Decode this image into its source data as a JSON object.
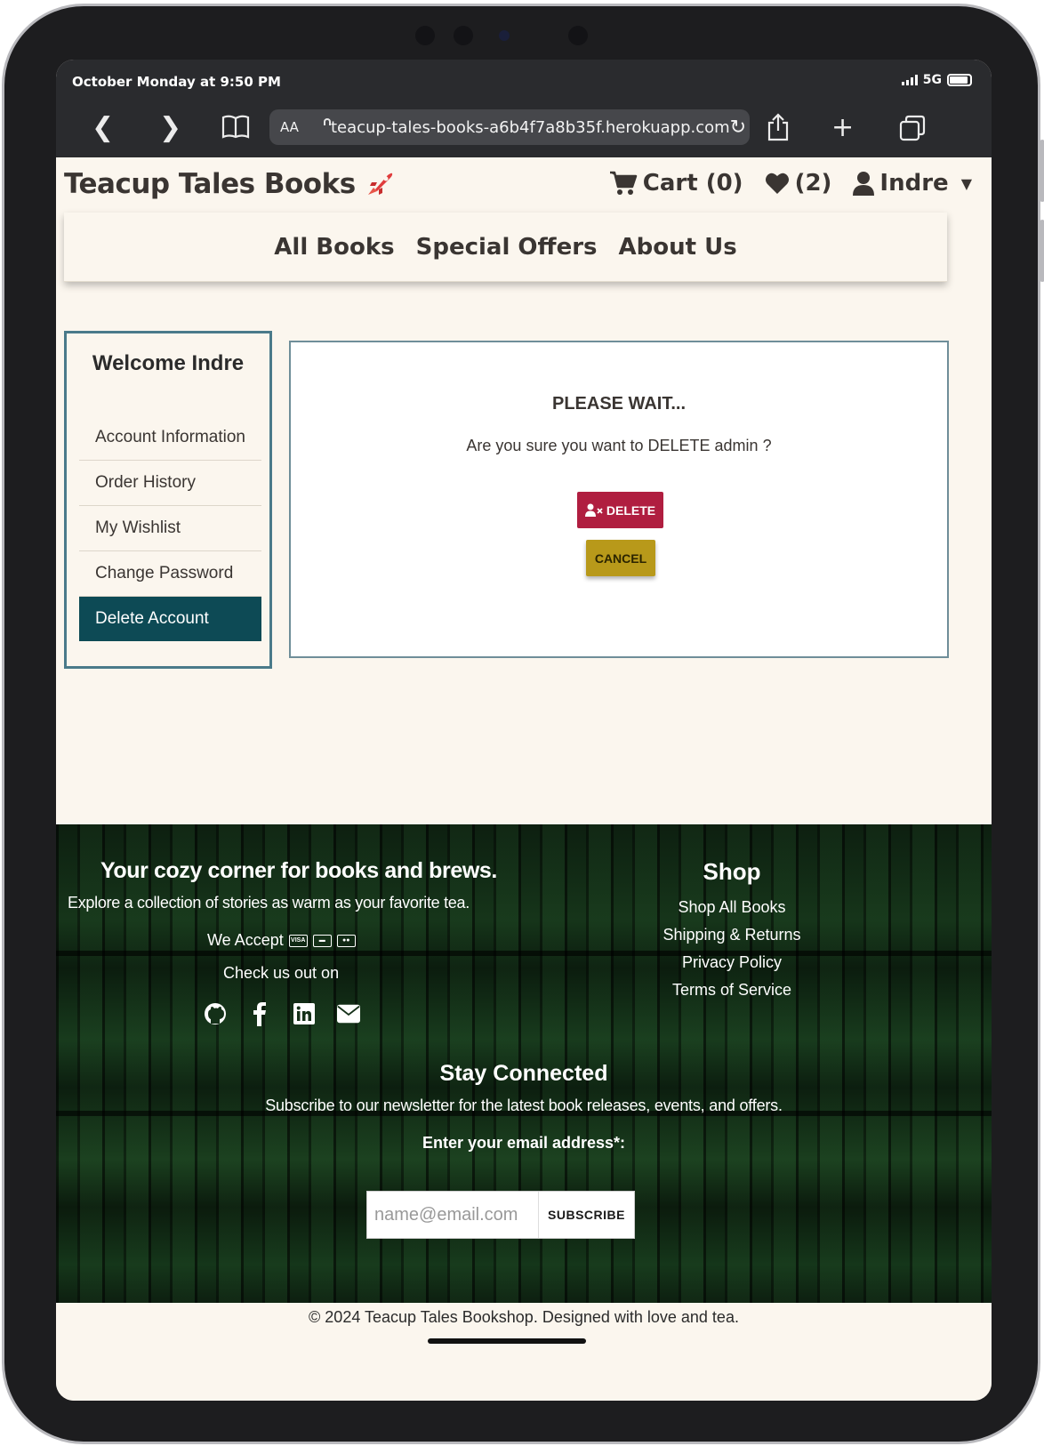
{
  "status_bar": {
    "time": "October Monday at 9:50 PM",
    "network": "5G"
  },
  "browser": {
    "text_size_label": "AA",
    "url": "teacup-tales-books-a6b4f7a8b35f.herokuapp.com",
    "icons": [
      "back-icon",
      "forward-icon",
      "bookmarks-icon",
      "reload-icon",
      "share-icon",
      "new-tab-icon",
      "tabs-icon"
    ]
  },
  "header": {
    "brand": "Teacup Tales Books",
    "cart": "Cart (0)",
    "wishlist_count": "(2)",
    "user": "Indre"
  },
  "nav": {
    "items": [
      "All Books",
      "Special Offers",
      "About Us"
    ]
  },
  "sidebar": {
    "title": "Welcome Indre",
    "items": [
      "Account Information",
      "Order History",
      "My Wishlist",
      "Change Password",
      "Delete Account"
    ],
    "active_index": 4
  },
  "dialog": {
    "title": "PLEASE WAIT...",
    "message": "Are you sure you want to DELETE admin ?",
    "delete_label": "DELETE",
    "cancel_label": "CANCEL"
  },
  "footer": {
    "tagline": "Your cozy corner for books and brews.",
    "subtitle": "Explore a collection of stories as warm as your favorite tea.",
    "accept_label": "We Accept",
    "payment_icons": [
      "visa-icon",
      "credit-card-icon",
      "mastercard-icon"
    ],
    "check_label": "Check us out on",
    "social_icons": [
      "github-icon",
      "facebook-icon",
      "linkedin-icon",
      "envelope-icon"
    ],
    "shop_title": "Shop",
    "shop_links": [
      "Shop All Books",
      "Shipping & Returns",
      "Privacy Policy",
      "Terms of Service"
    ],
    "stay_title": "Stay Connected",
    "newsletter_text": "Subscribe to our newsletter for the latest book releases, events, and offers.",
    "email_label": "Enter your email address*:",
    "email_placeholder": "name@email.com",
    "subscribe_label": "SUBSCRIBE",
    "copyright": "© 2024 Teacup Tales Bookshop. Designed with love and tea."
  },
  "colors": {
    "accent_dark_teal": "#0d4a55",
    "delete_red": "#b01e40",
    "cancel_gold": "#b8991a",
    "background_cream": "#fbf6ee"
  }
}
